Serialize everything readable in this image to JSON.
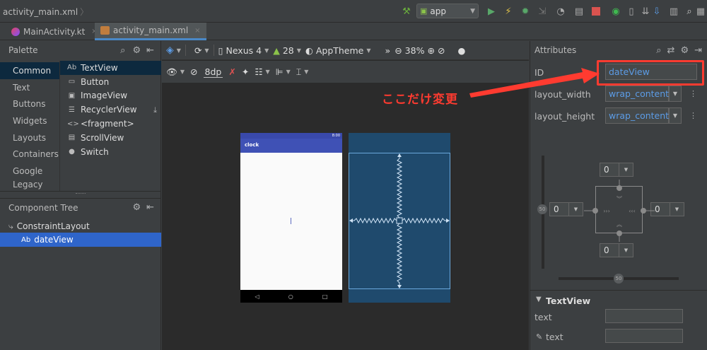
{
  "titlebar": {
    "breadcrumb": "activity_main.xml",
    "run_config": "app"
  },
  "tabs": [
    {
      "label": "MainActivity.kt",
      "close": "×"
    },
    {
      "label": "activity_main.xml",
      "close": "×"
    }
  ],
  "palette": {
    "title": "Palette",
    "categories": [
      "Common",
      "Text",
      "Buttons",
      "Widgets",
      "Layouts",
      "Containers",
      "Google",
      "Legacy"
    ],
    "items": [
      {
        "icon": "Ab",
        "label": "TextView"
      },
      {
        "icon": "▭",
        "label": "Button"
      },
      {
        "icon": "▣",
        "label": "ImageView"
      },
      {
        "icon": "☰",
        "label": "RecyclerView"
      },
      {
        "icon": "<>",
        "label": "<fragment>"
      },
      {
        "icon": "▤",
        "label": "ScrollView"
      },
      {
        "icon": "●",
        "label": "Switch"
      }
    ]
  },
  "component_tree": {
    "title": "Component Tree",
    "items": [
      {
        "icon": "⤷",
        "label": "ConstraintLayout"
      },
      {
        "icon": "Ab",
        "label": "dateView"
      }
    ]
  },
  "design_toolbar": {
    "device": "Nexus 4",
    "api": "28",
    "theme": "AppTheme",
    "zoom": "38%",
    "margin": "8dp"
  },
  "preview": {
    "app_title": "clock",
    "status_time": "8:00"
  },
  "attributes": {
    "title": "Attributes",
    "id_label": "ID",
    "id_value": "dateView",
    "layout_width_label": "layout_width",
    "layout_width_value": "wrap_content",
    "layout_height_label": "layout_height",
    "layout_height_value": "wrap_content",
    "margins": {
      "top": "0",
      "left": "0",
      "right": "0",
      "bottom": "0"
    },
    "bias_vertical": "50",
    "bias_horizontal": "50",
    "section_title": "TextView",
    "text_label": "text",
    "tools_text_label": "text"
  },
  "annotation": {
    "note": "ここだけ変更",
    "color": "#ff3b30"
  },
  "colors": {
    "accent": "#4a88c7",
    "selection": "#2f65ca",
    "blueprint": "#1f4a6d",
    "appbar": "#3f51b5"
  }
}
